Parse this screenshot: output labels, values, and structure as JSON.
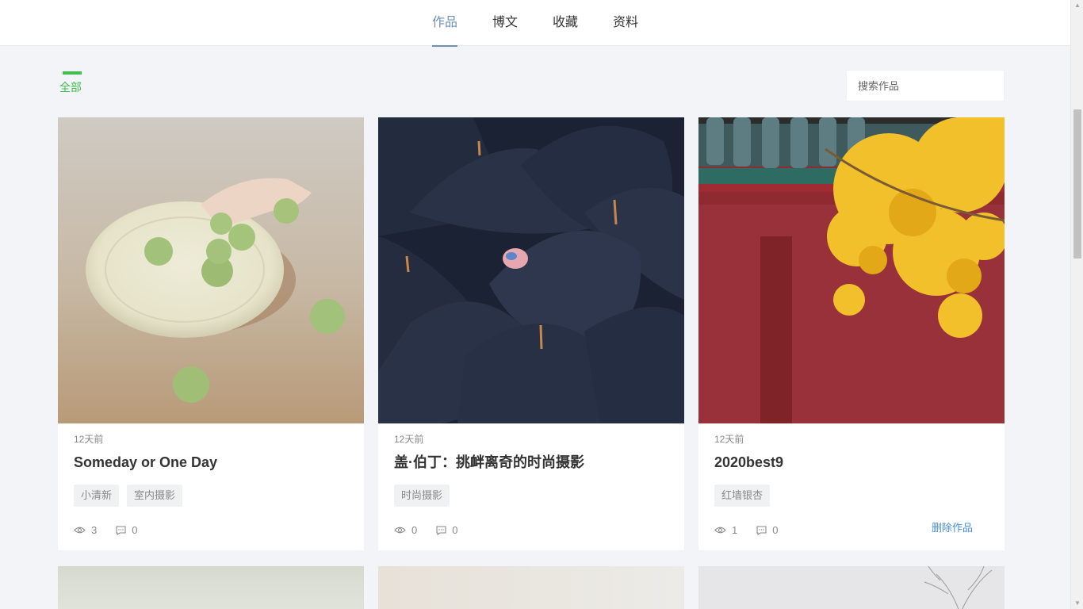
{
  "nav": {
    "tabs": [
      {
        "label": "作品",
        "active": true
      },
      {
        "label": "博文",
        "active": false
      },
      {
        "label": "收藏",
        "active": false
      },
      {
        "label": "资料",
        "active": false
      }
    ]
  },
  "filter": {
    "label": "全部"
  },
  "search": {
    "placeholder": "搜索作品",
    "icon": "search-icon"
  },
  "colors": {
    "accent": "#3fbf4f",
    "tab_active": "#6d8fb8",
    "link": "#4a8fde"
  },
  "cards": [
    {
      "time": "12天前",
      "title": "Someday or One Day",
      "tags": [
        "小清新",
        "室内摄影"
      ],
      "views": "3",
      "comments": "0"
    },
    {
      "time": "12天前",
      "title": "盖·伯丁：挑衅离奇的时尚摄影",
      "tags": [
        "时尚摄影"
      ],
      "views": "0",
      "comments": "0"
    },
    {
      "time": "12天前",
      "title": "2020best9",
      "tags": [
        "红墙银杏"
      ],
      "views": "1",
      "comments": "0",
      "action": "删除作品"
    }
  ]
}
